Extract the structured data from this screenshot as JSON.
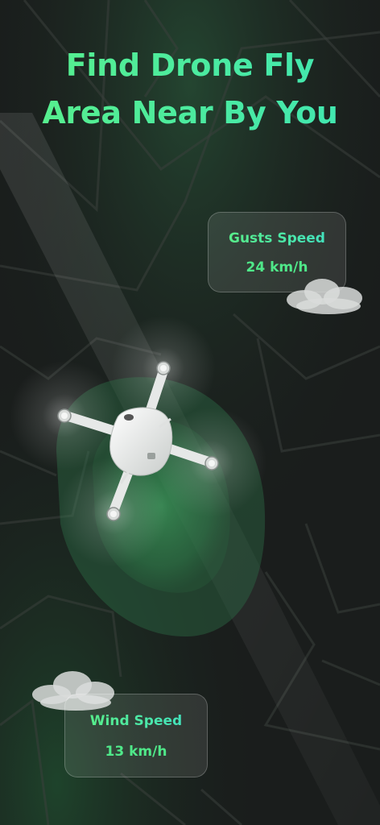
{
  "headline": {
    "line1": "Find Drone Fly",
    "line2": "Area Near By You"
  },
  "gusts_card": {
    "label": "Gusts Speed",
    "value": "24 km/h"
  },
  "wind_card": {
    "label": "Wind Speed",
    "value": "13 km/h"
  },
  "colors": {
    "background": "#1a1d1c",
    "accent_green": "#4fe889",
    "accent_teal": "#3ee0c8",
    "zone_green": "#3a8a55"
  },
  "icons": [
    "drone-illustration",
    "cloud-icon"
  ]
}
